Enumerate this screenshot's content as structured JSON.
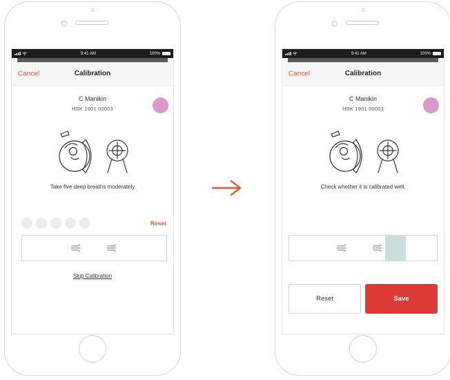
{
  "status_bar": {
    "time": "9:41 AM",
    "battery": "100%"
  },
  "left_screen": {
    "nav": {
      "cancel": "Cancel",
      "title": "Calibration"
    },
    "device": {
      "name": "C Manikin",
      "serial": "HSK 1901 00003",
      "dot_color": "#d99acb"
    },
    "instruction": "Take five deep breaths moderately",
    "progress": {
      "completed_breaths": 0,
      "total_breaths": 5
    },
    "reset_label": "Reset",
    "breath_indicators": 2,
    "skip_label": "Skip Calibration"
  },
  "right_screen": {
    "nav": {
      "cancel": "Cancel",
      "title": "Calibration"
    },
    "device": {
      "name": "C Manikin",
      "serial": "HSK 1901 00003",
      "dot_color": "#d99acb"
    },
    "instruction": "Check whether it is calibrated well.",
    "breath_indicators": 2,
    "highlight_color": "#c8dfdd",
    "buttons": {
      "reset": "Reset",
      "save": "Save"
    }
  },
  "colors": {
    "accent": "#e45a37",
    "save_button": "#dd3b35",
    "progress_dot": "#ececec"
  },
  "icons": [
    "wifi-icon",
    "battery-icon",
    "breath-wave-icon",
    "manikin-illustration",
    "target-icon",
    "flow-arrow-icon"
  ]
}
